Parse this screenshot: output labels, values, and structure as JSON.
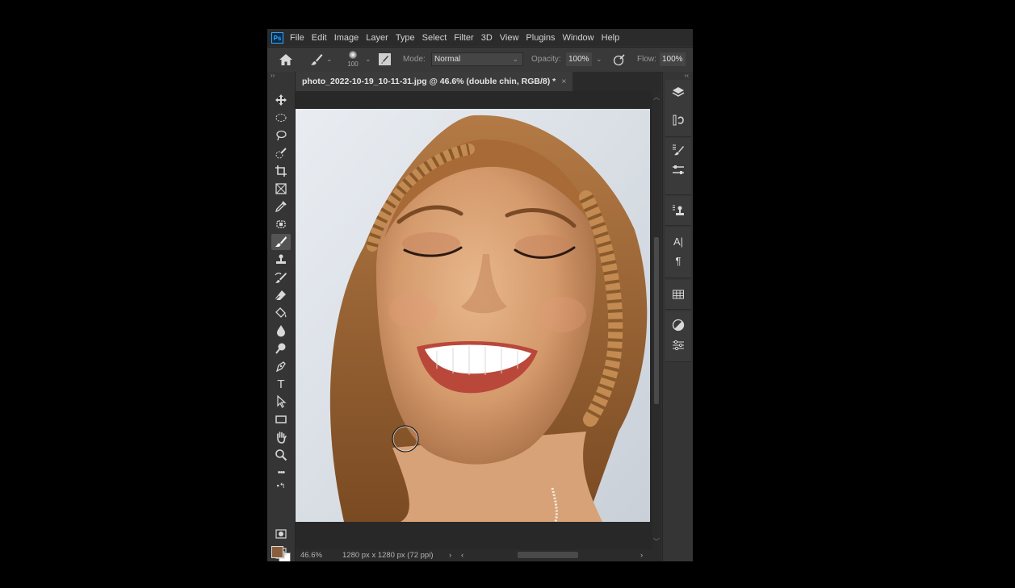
{
  "app": {
    "logo": "Ps"
  },
  "menubar": {
    "items": [
      "File",
      "Edit",
      "Image",
      "Layer",
      "Type",
      "Select",
      "Filter",
      "3D",
      "View",
      "Plugins",
      "Window",
      "Help"
    ]
  },
  "options": {
    "brush_size": "100",
    "mode_label": "Mode:",
    "mode_value": "Normal",
    "opacity_label": "Opacity:",
    "opacity_value": "100%",
    "flow_label": "Flow:",
    "flow_value": "100%"
  },
  "document": {
    "tab_title": "photo_2022-10-19_10-11-31.jpg @ 46.6% (double chin, RGB/8) *",
    "close_symbol": "×"
  },
  "status": {
    "zoom": "46.6%",
    "dimensions": "1280 px x 1280 px (72 ppi)",
    "arrow": "›",
    "left_arrow": "‹",
    "right_arrow": "›"
  },
  "colors": {
    "foreground": "#8a5e3c",
    "background": "#ffffff",
    "ui_dark": "#303030",
    "accent": "#31a8ff"
  },
  "toolbar": {
    "tools": [
      "move-icon",
      "marquee-icon",
      "lasso-icon",
      "quick-select-icon",
      "crop-icon",
      "frame-icon",
      "eyedropper-icon",
      "healing-icon",
      "brush-icon",
      "stamp-icon",
      "history-brush-icon",
      "eraser-icon",
      "paint-bucket-icon",
      "blur-icon",
      "dodge-icon",
      "pen-icon",
      "type-icon",
      "path-select-icon",
      "rectangle-icon",
      "hand-icon",
      "zoom-icon",
      "more-tools-icon"
    ],
    "type_tool_glyph": "T"
  },
  "right_panel": {
    "icons": [
      "layers-icon",
      "history-icon",
      "brush-settings-icon",
      "properties-icon",
      "clone-source-icon",
      "character-icon",
      "paragraph-icon",
      "swatches-grid-icon",
      "adjustments-icon",
      "libraries-icon"
    ],
    "character_glyph": "A|",
    "paragraph_glyph": "¶"
  }
}
